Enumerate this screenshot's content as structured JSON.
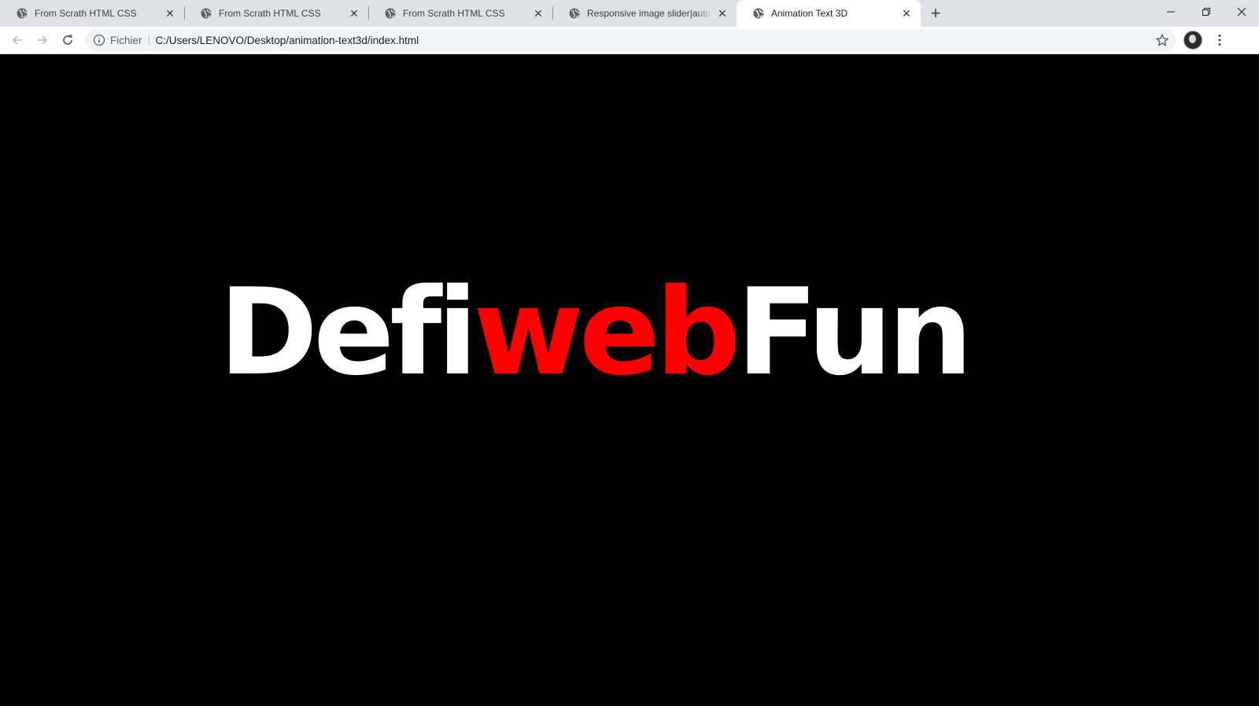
{
  "browser": {
    "tabs": [
      {
        "title": "From Scrath HTML CSS",
        "active": false,
        "icon": "globe-icon"
      },
      {
        "title": "From Scrath HTML CSS",
        "active": false,
        "icon": "globe-icon"
      },
      {
        "title": "From Scrath HTML CSS",
        "active": false,
        "icon": "globe-icon"
      },
      {
        "title": "Responsive image slider|autoplay",
        "active": false,
        "icon": "globe-icon"
      },
      {
        "title": "Animation Text 3D",
        "active": true,
        "icon": "globe-icon"
      }
    ],
    "new_tab_label": "+",
    "window_controls": {
      "minimize": "—",
      "restore": "❐",
      "close": "✕"
    },
    "address_bar": {
      "scheme_label": "Fichier",
      "url": "C:/Users/LENOVO/Desktop/animation-text3d/index.html"
    }
  },
  "page": {
    "headline": {
      "part1": "Defi",
      "part2": "web",
      "part3": "Fun"
    },
    "colors": {
      "background": "#000000",
      "text_primary": "#ffffff",
      "text_accent": "#ff0000"
    }
  }
}
